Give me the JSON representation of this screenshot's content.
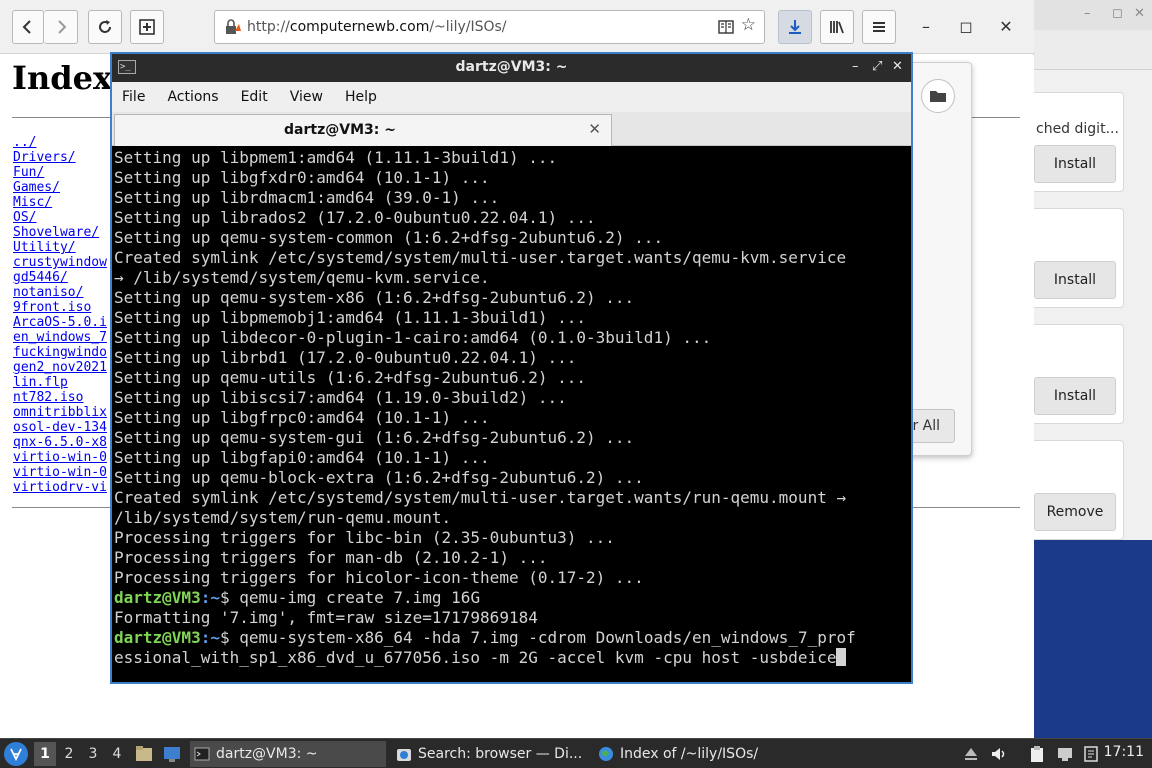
{
  "browser": {
    "url_host": "computernewb.com",
    "url_path": "/~lily/ISOs/",
    "page_title": "Index",
    "files": [
      "../",
      "Drivers/",
      "Fun/",
      "Games/",
      "Misc/",
      "OS/",
      "Shovelware/",
      "Utility/",
      "crustywindow",
      "gd5446/",
      "notaniso/",
      "9front.iso",
      "ArcaOS-5.0.i",
      "en_windows_7",
      "fuckingwindo",
      "gen2_nov2021",
      "lin.flp",
      "nt782.iso",
      "omnitribblix",
      "osol-dev-134",
      "qnx-6.5.0-x8",
      "virtio-win-0",
      "virtio-win-0",
      "virtiodrv-vi"
    ]
  },
  "downloads": {
    "clear_label": "r All"
  },
  "store": {
    "cards": [
      {
        "desc": "ched digit...",
        "button": "Install"
      },
      {
        "desc": "",
        "button": "Install"
      },
      {
        "desc": "",
        "button": "Install"
      },
      {
        "desc": "",
        "button": "Remove"
      }
    ]
  },
  "terminal": {
    "title": "dartz@VM3: ~",
    "tab_label": "dartz@VM3: ~",
    "menus": [
      "File",
      "Edit",
      "View",
      "Help",
      "Actions"
    ],
    "menu_order": [
      "File",
      "Actions",
      "Edit",
      "View",
      "Help"
    ],
    "lines": [
      "Setting up libpmem1:amd64 (1.11.1-3build1) ...",
      "Setting up libgfxdr0:amd64 (10.1-1) ...",
      "Setting up librdmacm1:amd64 (39.0-1) ...",
      "Setting up librados2 (17.2.0-0ubuntu0.22.04.1) ...",
      "Setting up qemu-system-common (1:6.2+dfsg-2ubuntu6.2) ...",
      "Created symlink /etc/systemd/system/multi-user.target.wants/qemu-kvm.service",
      "→ /lib/systemd/system/qemu-kvm.service.",
      "Setting up qemu-system-x86 (1:6.2+dfsg-2ubuntu6.2) ...",
      "Setting up libpmemobj1:amd64 (1.11.1-3build1) ...",
      "Setting up libdecor-0-plugin-1-cairo:amd64 (0.1.0-3build1) ...",
      "Setting up librbd1 (17.2.0-0ubuntu0.22.04.1) ...",
      "Setting up qemu-utils (1:6.2+dfsg-2ubuntu6.2) ...",
      "Setting up libiscsi7:amd64 (1.19.0-3build2) ...",
      "Setting up libgfrpc0:amd64 (10.1-1) ...",
      "Setting up qemu-system-gui (1:6.2+dfsg-2ubuntu6.2) ...",
      "Setting up libgfapi0:amd64 (10.1-1) ...",
      "Setting up qemu-block-extra (1:6.2+dfsg-2ubuntu6.2) ...",
      "Created symlink /etc/systemd/system/multi-user.target.wants/run-qemu.mount →",
      "/lib/systemd/system/run-qemu.mount.",
      "Processing triggers for libc-bin (2.35-0ubuntu3) ...",
      "Processing triggers for man-db (2.10.2-1) ...",
      "Processing triggers for hicolor-icon-theme (0.17-2) ..."
    ],
    "prompt_user": "dartz@VM3",
    "prompt_path": "~",
    "cmd1": "$ qemu-img create 7.img 16G",
    "cmd1_output": "Formatting '7.img', fmt=raw size=17179869184",
    "cmd2_line1": "$ qemu-system-x86_64 -hda 7.img -cdrom Downloads/en_windows_7_prof",
    "cmd2_line2": "essional_with_sp1_x86_dvd_u_677056.iso -m 2G -accel kvm -cpu host -usbdeice"
  },
  "taskbar": {
    "workspaces": [
      "1",
      "2",
      "3",
      "4"
    ],
    "tasks": [
      "dartz@VM3: ~",
      "Search: browser — Di...",
      "Index of /~lily/ISOs/"
    ],
    "clock": "17:11"
  },
  "colors": {
    "prompt_user": "#7fd655",
    "prompt_path": "#5c9ce6",
    "accent": "#3d7ecf"
  }
}
